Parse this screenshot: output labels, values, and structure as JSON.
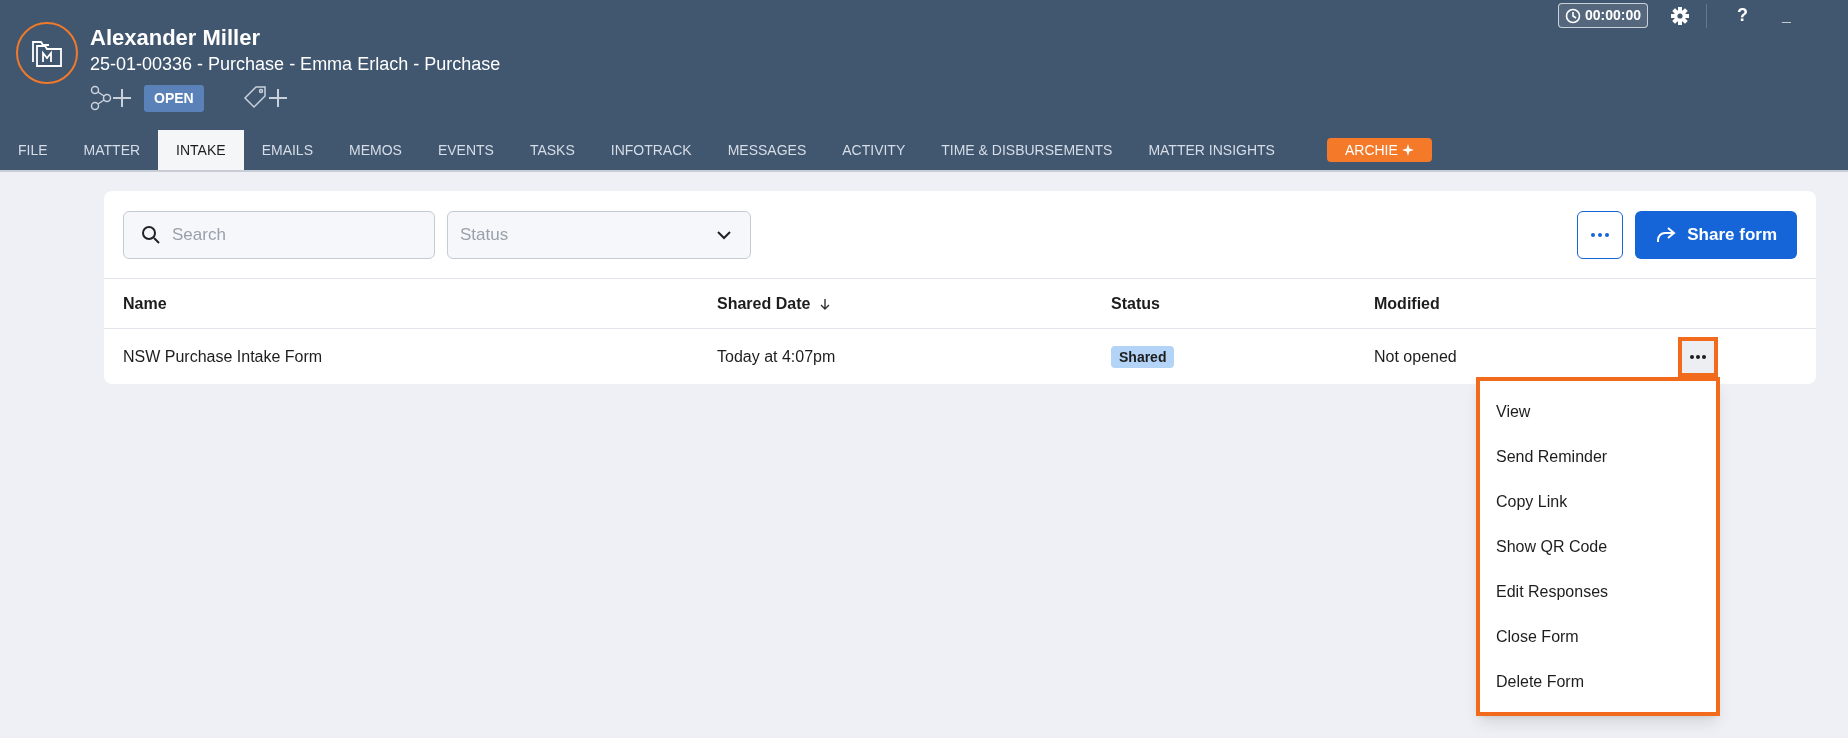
{
  "header": {
    "title": "Alexander Miller",
    "subtitle": "25-01-00336 - Purchase - Emma Erlach - Purchase",
    "status_badge": "OPEN"
  },
  "top_bar": {
    "timer": "00:00:00",
    "help": "?",
    "minimize": "_"
  },
  "tabs": [
    {
      "label": "FILE",
      "selected": false,
      "kind": "tab"
    },
    {
      "label": "MATTER",
      "selected": false,
      "kind": "tab"
    },
    {
      "label": "INTAKE",
      "selected": true,
      "kind": "tab"
    },
    {
      "label": "EMAILS",
      "selected": false,
      "kind": "tab"
    },
    {
      "label": "MEMOS",
      "selected": false,
      "kind": "tab"
    },
    {
      "label": "EVENTS",
      "selected": false,
      "kind": "tab"
    },
    {
      "label": "TASKS",
      "selected": false,
      "kind": "tab"
    },
    {
      "label": "INFOTRACK",
      "selected": false,
      "kind": "tab"
    },
    {
      "label": "MESSAGES",
      "selected": false,
      "kind": "tab"
    },
    {
      "label": "ACTIVITY",
      "selected": false,
      "kind": "tab"
    },
    {
      "label": "TIME & DISBURSEMENTS",
      "selected": false,
      "kind": "tab"
    },
    {
      "label": "MATTER INSIGHTS",
      "selected": false,
      "kind": "tab"
    },
    {
      "label": "ARCHIE",
      "selected": false,
      "kind": "ai"
    }
  ],
  "toolbar": {
    "search": {
      "placeholder": "Search"
    },
    "status_filter": {
      "placeholder": "Status"
    },
    "share_button": "Share form"
  },
  "table": {
    "columns": [
      {
        "label": "Name",
        "sorted": false
      },
      {
        "label": "Shared Date",
        "sorted": true
      },
      {
        "label": "Status",
        "sorted": false
      },
      {
        "label": "Modified",
        "sorted": false
      }
    ],
    "rows": [
      {
        "name": "NSW Purchase Intake Form",
        "shared_date": "Today at 4:07pm",
        "status": "Shared",
        "modified": "Not opened"
      }
    ]
  },
  "row_menu": {
    "items": [
      "View",
      "Send Reminder",
      "Copy Link",
      "Show QR Code",
      "Edit Responses",
      "Close Form",
      "Delete Form"
    ]
  }
}
